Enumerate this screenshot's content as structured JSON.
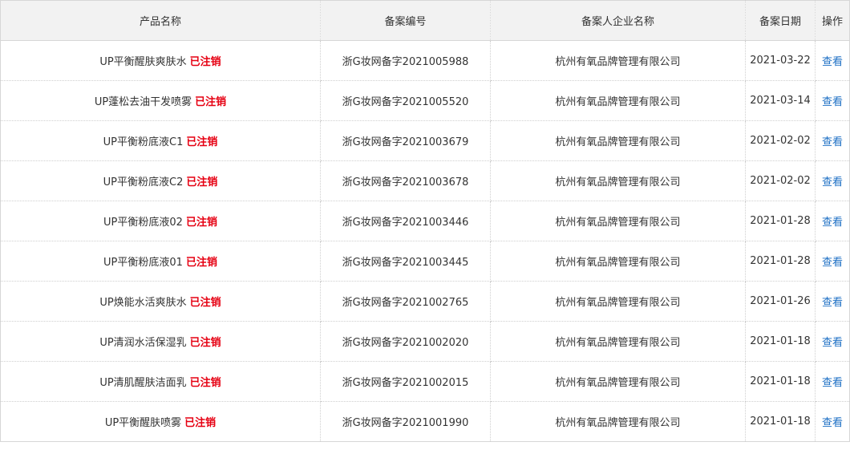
{
  "table": {
    "headers": {
      "product_name": "产品名称",
      "record_number": "备案编号",
      "company": "备案人企业名称",
      "date": "备案日期",
      "action": "操作"
    },
    "rows": [
      {
        "product_name": "UP平衡醒肤爽肤水",
        "status": "已注销",
        "record_number": "浙G妆网备字2021005988",
        "company": "杭州有氧品牌管理有限公司",
        "date": "2021-03-22",
        "action": "查看"
      },
      {
        "product_name": "UP蓬松去油干发喷雾",
        "status": "已注销",
        "record_number": "浙G妆网备字2021005520",
        "company": "杭州有氧品牌管理有限公司",
        "date": "2021-03-14",
        "action": "查看"
      },
      {
        "product_name": "UP平衡粉底液C1",
        "status": "已注销",
        "record_number": "浙G妆网备字2021003679",
        "company": "杭州有氧品牌管理有限公司",
        "date": "2021-02-02",
        "action": "查看"
      },
      {
        "product_name": "UP平衡粉底液C2",
        "status": "已注销",
        "record_number": "浙G妆网备字2021003678",
        "company": "杭州有氧品牌管理有限公司",
        "date": "2021-02-02",
        "action": "查看"
      },
      {
        "product_name": "UP平衡粉底液02",
        "status": "已注销",
        "record_number": "浙G妆网备字2021003446",
        "company": "杭州有氧品牌管理有限公司",
        "date": "2021-01-28",
        "action": "查看"
      },
      {
        "product_name": "UP平衡粉底液01",
        "status": "已注销",
        "record_number": "浙G妆网备字2021003445",
        "company": "杭州有氧品牌管理有限公司",
        "date": "2021-01-28",
        "action": "查看"
      },
      {
        "product_name": "UP焕能水活爽肤水",
        "status": "已注销",
        "record_number": "浙G妆网备字2021002765",
        "company": "杭州有氧品牌管理有限公司",
        "date": "2021-01-26",
        "action": "查看"
      },
      {
        "product_name": "UP清润水活保湿乳",
        "status": "已注销",
        "record_number": "浙G妆网备字2021002020",
        "company": "杭州有氧品牌管理有限公司",
        "date": "2021-01-18",
        "action": "查看"
      },
      {
        "product_name": "UP清肌醒肤洁面乳",
        "status": "已注销",
        "record_number": "浙G妆网备字2021002015",
        "company": "杭州有氧品牌管理有限公司",
        "date": "2021-01-18",
        "action": "查看"
      },
      {
        "product_name": "UP平衡醒肤喷雾",
        "status": "已注销",
        "record_number": "浙G妆网备字2021001990",
        "company": "杭州有氧品牌管理有限公司",
        "date": "2021-01-18",
        "action": "查看"
      }
    ]
  },
  "colors": {
    "header_background": "#f2f2f2",
    "status_red": "#e60012",
    "link_blue": "#1d6fc4",
    "border": "#d7d7d7"
  }
}
